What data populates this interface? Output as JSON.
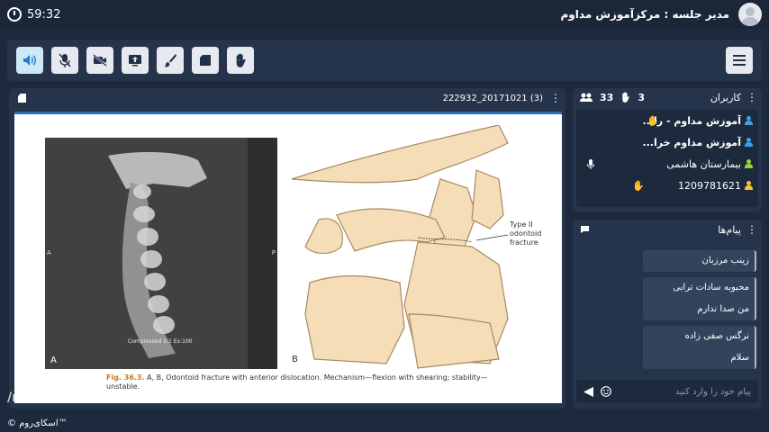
{
  "timer": "59:32",
  "session_user": "مدیر جلسه : مرکزآموزش مداوم",
  "slide": {
    "filename": "222932_20171021 (3)",
    "ct_label": "A",
    "ct_side_a": "A",
    "ct_side_p": "P",
    "ct_scan_text": "Compressed 5:1 Ex:100",
    "diagram_label": "B",
    "type_label": [
      "Type II",
      "odontoid",
      "fracture"
    ],
    "caption_fig": "Fig. 36.3.",
    "caption_text": " A, B, Odontoid fracture with anterior dislocation. Mechanism—flexion with shearing; stability— unstable."
  },
  "users_panel": {
    "title": "کاربران",
    "count_total": "33",
    "count_hands": "3",
    "items": [
      {
        "name": "آموزش مداوم - را...",
        "color": "#3aa0e8",
        "bold": true
      },
      {
        "name": "آموزش مداوم خرا...",
        "color": "#3aa0e8",
        "bold": true
      },
      {
        "name": "بیمارستان هاشمی",
        "color": "#9bd23c",
        "bold": false
      },
      {
        "name": "1209781621",
        "color": "#f0c53a",
        "bold": false
      }
    ]
  },
  "messages_panel": {
    "title": "پیام‌ها",
    "messages": [
      {
        "lines": [
          "زینب مرزبان"
        ]
      },
      {
        "lines": [
          "محبوبه سادات ترابی",
          "من صدا ندارم"
        ]
      },
      {
        "lines": [
          "نرگس صفی زاده",
          "سلام"
        ]
      }
    ],
    "input_placeholder": "پیام خود را وارد کنید"
  },
  "watermark_handle": "/nkumscme",
  "watermark_brand": "© اسکای‌روم™"
}
